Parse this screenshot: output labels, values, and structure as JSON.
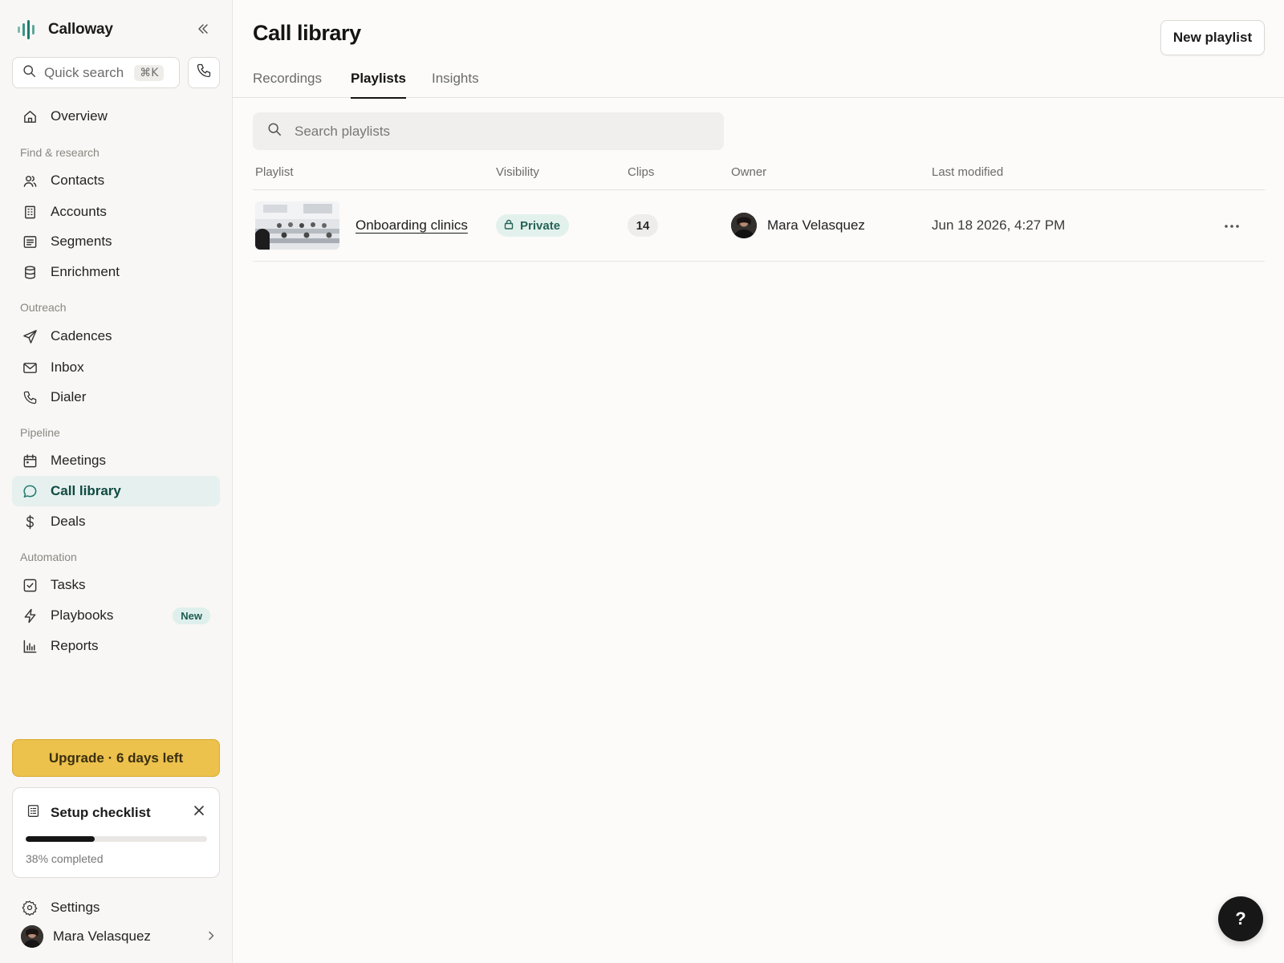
{
  "brand": {
    "name": "Calloway",
    "logo_icon": "waveform-logo-icon",
    "accent": "#1f7a6c"
  },
  "sidebar": {
    "collapse_icon": "chevrons-left-icon",
    "quick_search": {
      "placeholder": "Quick search",
      "shortcut": "⌘K"
    },
    "dial_icon": "phone-icon",
    "overview": {
      "label": "Overview",
      "icon": "home-icon"
    },
    "sections": {
      "find": "Find & research",
      "outreach": "Outreach",
      "pipeline": "Pipeline",
      "automation": "Automation"
    },
    "items": {
      "contacts": "Contacts",
      "accounts": "Accounts",
      "segments": "Segments",
      "enrichment": "Enrichment",
      "cadences": "Cadences",
      "inbox": "Inbox",
      "dialer": "Dialer",
      "meetings": "Meetings",
      "call_library": "Call library",
      "deals": "Deals",
      "tasks": "Tasks",
      "playbooks": "Playbooks",
      "reports": "Reports"
    },
    "active_item": "Call library",
    "playbooks_badge": "New",
    "upgrade": {
      "label": "Upgrade · 6 days left",
      "color": "#ecc14c"
    },
    "checklist": {
      "title": "Setup checklist",
      "progress_percent": 38,
      "progress_text": "38% completed"
    },
    "settings": {
      "label": "Settings"
    },
    "user": {
      "name": "Mara Velasquez"
    }
  },
  "page": {
    "title": "Call library",
    "new_button": "New playlist",
    "tabs": [
      "Recordings",
      "Playlists",
      "Insights"
    ],
    "active_tab": "Playlists",
    "search": {
      "placeholder": "Search playlists"
    },
    "table": {
      "columns": [
        "Playlist",
        "Visibility",
        "Clips",
        "Owner",
        "Last modified"
      ],
      "rows": [
        {
          "name": "Onboarding clinics",
          "visibility": "Private",
          "visibility_icon": "lock-icon",
          "clips": "14",
          "owner": "Mara Velasquez",
          "last_modified": "Jun 18 2026, 4:27 PM",
          "actions_icon": "more-horizontal-icon"
        }
      ]
    }
  },
  "help": {
    "label": "?"
  }
}
